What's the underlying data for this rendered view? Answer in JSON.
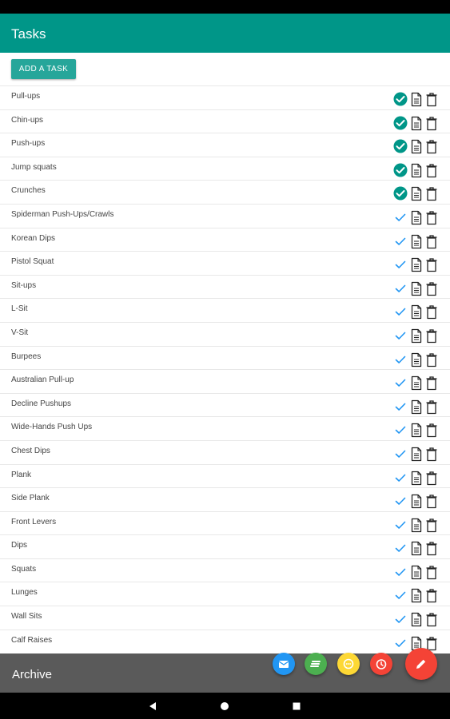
{
  "app": {
    "title": "Tasks"
  },
  "toolbar": {
    "add_task_label": "ADD A TASK"
  },
  "tasks": [
    {
      "label": "Pull-ups",
      "done": true
    },
    {
      "label": "Chin-ups",
      "done": true
    },
    {
      "label": "Push-ups",
      "done": true
    },
    {
      "label": "Jump squats",
      "done": true
    },
    {
      "label": "Crunches",
      "done": true
    },
    {
      "label": "Spiderman Push-Ups/Crawls",
      "done": false
    },
    {
      "label": "Korean Dips",
      "done": false
    },
    {
      "label": "Pistol Squat",
      "done": false
    },
    {
      "label": "Sit-ups",
      "done": false
    },
    {
      "label": "L-Sit",
      "done": false
    },
    {
      "label": "V-Sit",
      "done": false
    },
    {
      "label": "Burpees",
      "done": false
    },
    {
      "label": "Australian Pull-up",
      "done": false
    },
    {
      "label": "Decline Pushups",
      "done": false
    },
    {
      "label": "Wide-Hands Push Ups",
      "done": false
    },
    {
      "label": "Chest Dips",
      "done": false
    },
    {
      "label": "Plank",
      "done": false
    },
    {
      "label": "Side Plank",
      "done": false
    },
    {
      "label": "Front Levers",
      "done": false
    },
    {
      "label": "Dips",
      "done": false
    },
    {
      "label": "Squats",
      "done": false
    },
    {
      "label": "Lunges",
      "done": false
    },
    {
      "label": "Wall Sits",
      "done": false
    },
    {
      "label": "Calf Raises",
      "done": false
    }
  ],
  "archive": {
    "label": "Archive"
  },
  "fabs": [
    {
      "icon": "mail-icon",
      "color": "#2196f3"
    },
    {
      "icon": "list-icon",
      "color": "#4caf50"
    },
    {
      "icon": "message-icon",
      "color": "#fdd835"
    },
    {
      "icon": "alarm-icon",
      "color": "#f44336"
    }
  ],
  "main_fab": {
    "icon": "pencil-icon",
    "color": "#f44336"
  },
  "colors": {
    "primary": "#009688",
    "accent_button": "#26a69a",
    "check_done": "#009688",
    "check_pending": "#2196f3",
    "archive_bg": "#5a5a5a"
  }
}
